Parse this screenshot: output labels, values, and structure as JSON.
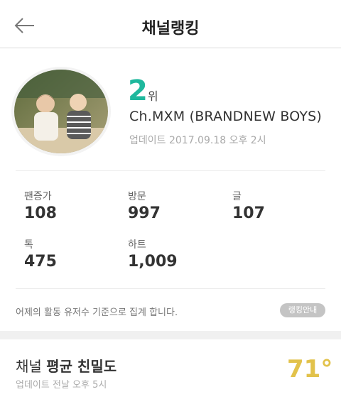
{
  "header": {
    "title": "채널랭킹"
  },
  "rank": {
    "number": "2",
    "unit": "위"
  },
  "channel": {
    "name": "Ch.MXM (BRANDNEW BOYS)",
    "updated": "업데이트 2017.09.18 오후 2시"
  },
  "stats": [
    {
      "label": "팬증가",
      "value": "108"
    },
    {
      "label": "방문",
      "value": "997"
    },
    {
      "label": "글",
      "value": "107"
    },
    {
      "label": "톡",
      "value": "475"
    },
    {
      "label": "하트",
      "value": "1,009"
    }
  ],
  "note": "어제의 활동 유저수 기준으로 집계 합니다.",
  "guide_button": "랭킹안내",
  "intimacy": {
    "prefix": "채널",
    "bold": "평균 친밀도",
    "updated": "업데이트 전날 오후 5시",
    "value": "71°"
  },
  "colors": {
    "rank": "#1fb89d",
    "intimacy": "#e2c24b"
  }
}
